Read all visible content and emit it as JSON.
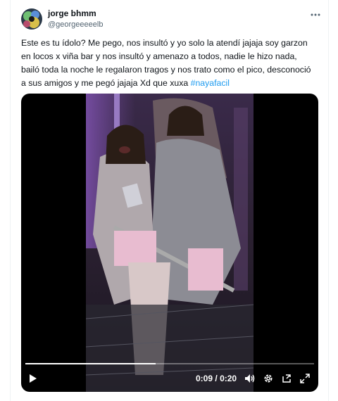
{
  "tweet": {
    "author": {
      "display_name": "jorge bhmm",
      "handle": "@georgeeeeelb"
    },
    "text_before": "Este es tu ídolo? Me pego, nos insultó y yo solo la atendí jajaja soy garzon en locos x viña bar y nos insultó y amenazo a todos, nadie le hizo nada, bailó toda la noche le regalaron tragos y nos trato como el pico, desconoció a sus amigos y me pegó jajaja Xd que xuxa ",
    "hashtag": "#nayafacil"
  },
  "video": {
    "time_current": "0:09",
    "time_separator": "/",
    "time_total": "0:20",
    "progress": 0.45
  },
  "icons": {
    "more": "more-options-icon",
    "play": "play-icon",
    "volume": "volume-icon",
    "settings": "gear-icon",
    "pip": "picture-in-picture-icon",
    "fullscreen": "fullscreen-icon"
  },
  "colors": {
    "link": "#1d9bf0",
    "text": "#0f1419",
    "secondary": "#536471"
  }
}
